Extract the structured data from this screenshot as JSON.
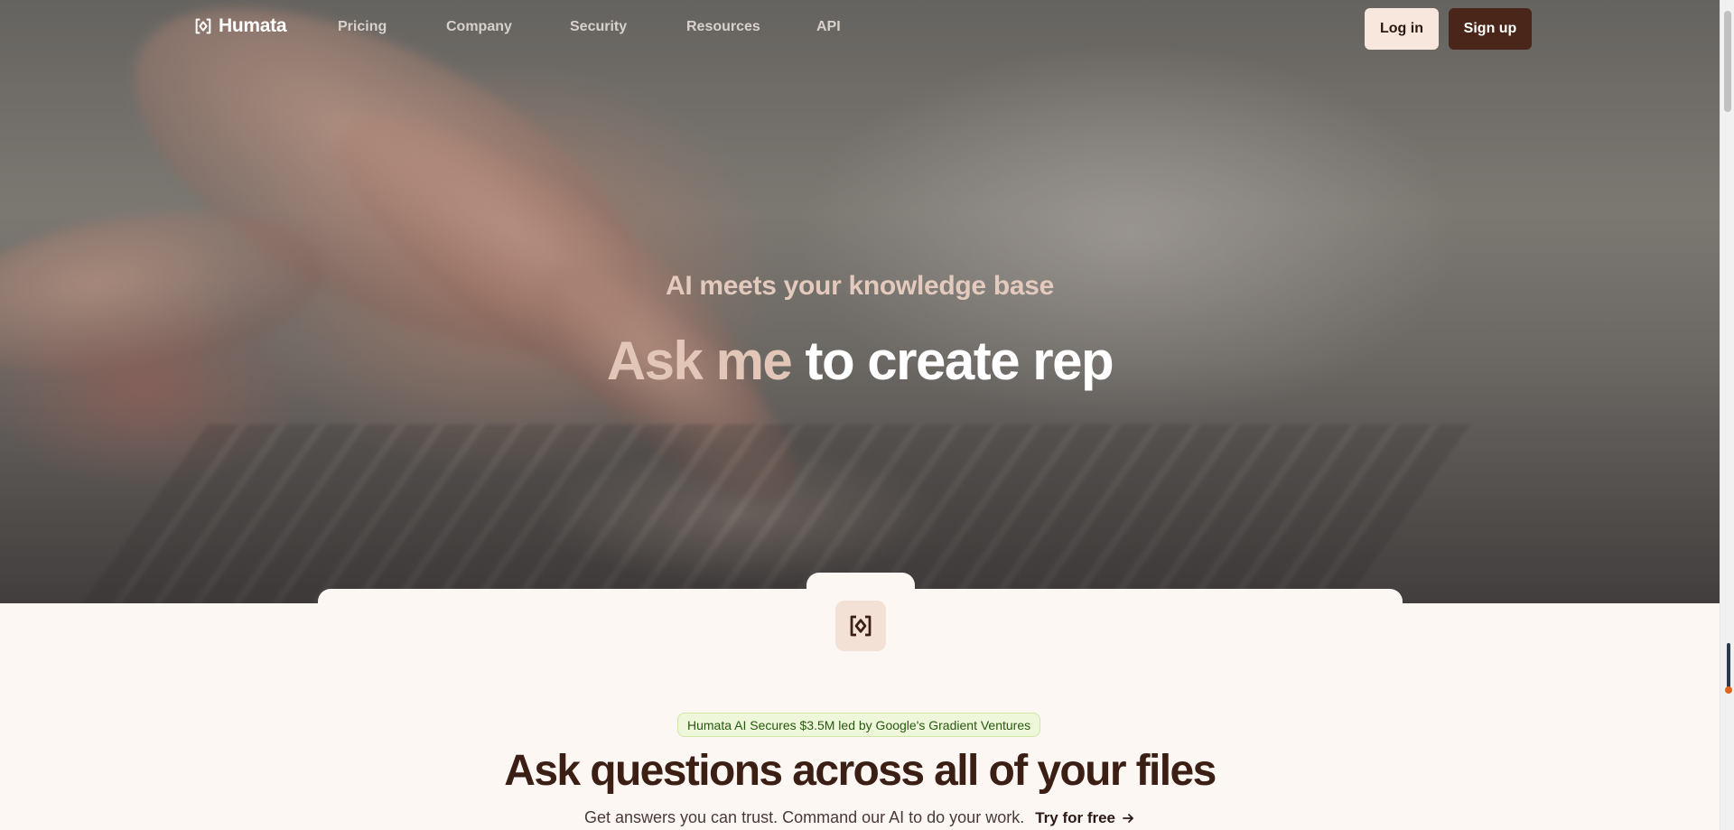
{
  "nav": {
    "brand": "Humata",
    "links": [
      "Pricing",
      "Company",
      "Security",
      "Resources",
      "API"
    ],
    "login_label": "Log in",
    "signup_label": "Sign up"
  },
  "hero": {
    "eyebrow": "AI meets your knowledge base",
    "headline_highlight": "Ask me",
    "headline_rest": "to create rep"
  },
  "content": {
    "badge": "Humata AI Secures $3.5M led by Google's Gradient Ventures",
    "title": "Ask questions across all of your files",
    "subtitle": "Get answers you can trust. Command our AI to do your work.",
    "cta": "Try for free"
  },
  "icons": {
    "logo": "humata-logo-icon",
    "card": "humata-logo-icon",
    "cta_arrow": "arrow-right-icon"
  },
  "colors": {
    "page_bg": "#fdf7f3",
    "signup_bg": "#4a2519",
    "login_bg": "#f7e7dd",
    "title_text": "#3b1f15",
    "badge_bg": "#eef7da",
    "badge_text": "#28580f"
  }
}
